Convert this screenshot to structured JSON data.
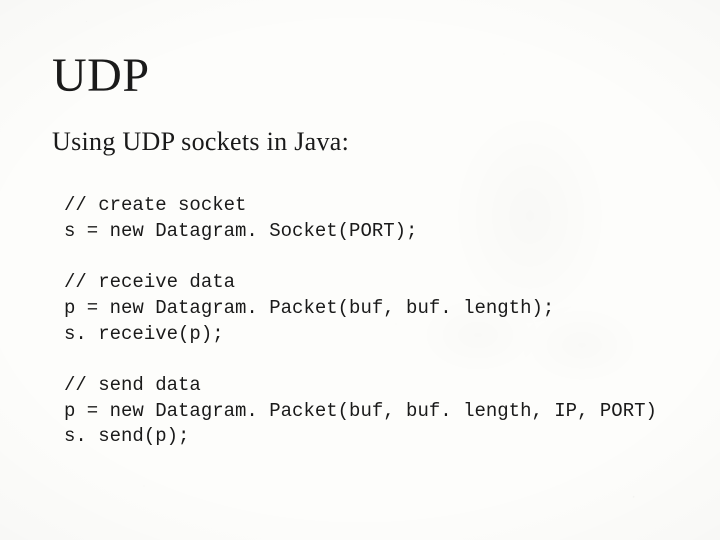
{
  "title": "UDP",
  "subtitle": "Using UDP sockets in Java:",
  "blocks": [
    {
      "comment": "// create socket",
      "code": "s = new Datagram. Socket(PORT);"
    },
    {
      "comment": "// receive data",
      "code": "p = new Datagram. Packet(buf, buf. length);\ns. receive(p);"
    },
    {
      "comment": "// send data",
      "code": "p = new Datagram. Packet(buf, buf. length, IP, PORT)\ns. send(p);"
    }
  ]
}
